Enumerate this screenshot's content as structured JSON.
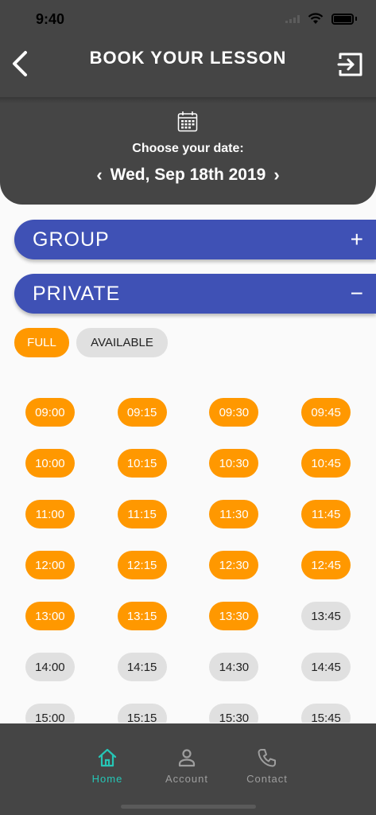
{
  "status_bar": {
    "time": "9:40"
  },
  "header": {
    "title": "BOOK YOUR LESSON",
    "date_caption": "Choose your date:",
    "date_value": "Wed, Sep 18th 2019",
    "prev_glyph": "‹",
    "next_glyph": "›"
  },
  "sections": {
    "group": {
      "label": "GROUP",
      "sign": "+"
    },
    "private": {
      "label": "PRIVATE",
      "sign": "−"
    }
  },
  "legend": {
    "full": "FULL",
    "available": "AVAILABLE"
  },
  "slots": [
    {
      "time": "09:00",
      "status": "full"
    },
    {
      "time": "09:15",
      "status": "full"
    },
    {
      "time": "09:30",
      "status": "full"
    },
    {
      "time": "09:45",
      "status": "full"
    },
    {
      "time": "10:00",
      "status": "full"
    },
    {
      "time": "10:15",
      "status": "full"
    },
    {
      "time": "10:30",
      "status": "full"
    },
    {
      "time": "10:45",
      "status": "full"
    },
    {
      "time": "11:00",
      "status": "full"
    },
    {
      "time": "11:15",
      "status": "full"
    },
    {
      "time": "11:30",
      "status": "full"
    },
    {
      "time": "11:45",
      "status": "full"
    },
    {
      "time": "12:00",
      "status": "full"
    },
    {
      "time": "12:15",
      "status": "full"
    },
    {
      "time": "12:30",
      "status": "full"
    },
    {
      "time": "12:45",
      "status": "full"
    },
    {
      "time": "13:00",
      "status": "full"
    },
    {
      "time": "13:15",
      "status": "full"
    },
    {
      "time": "13:30",
      "status": "full"
    },
    {
      "time": "13:45",
      "status": "available"
    },
    {
      "time": "14:00",
      "status": "available"
    },
    {
      "time": "14:15",
      "status": "available"
    },
    {
      "time": "14:30",
      "status": "available"
    },
    {
      "time": "14:45",
      "status": "available"
    },
    {
      "time": "15:00",
      "status": "available"
    },
    {
      "time": "15:15",
      "status": "available"
    },
    {
      "time": "15:30",
      "status": "available"
    },
    {
      "time": "15:45",
      "status": "available"
    }
  ],
  "bottom_nav": {
    "home": "Home",
    "account": "Account",
    "contact": "Contact"
  },
  "icons": {
    "back": "back-arrow-icon",
    "exit": "logout-icon",
    "calendar": "calendar-icon",
    "home": "home-icon",
    "account": "person-icon",
    "contact": "phone-icon"
  },
  "colors": {
    "header_bg": "#454545",
    "section_bar": "#3f51b5",
    "full": "#ff9800",
    "available": "#e0e0e0",
    "active_nav": "#26c6b6"
  }
}
